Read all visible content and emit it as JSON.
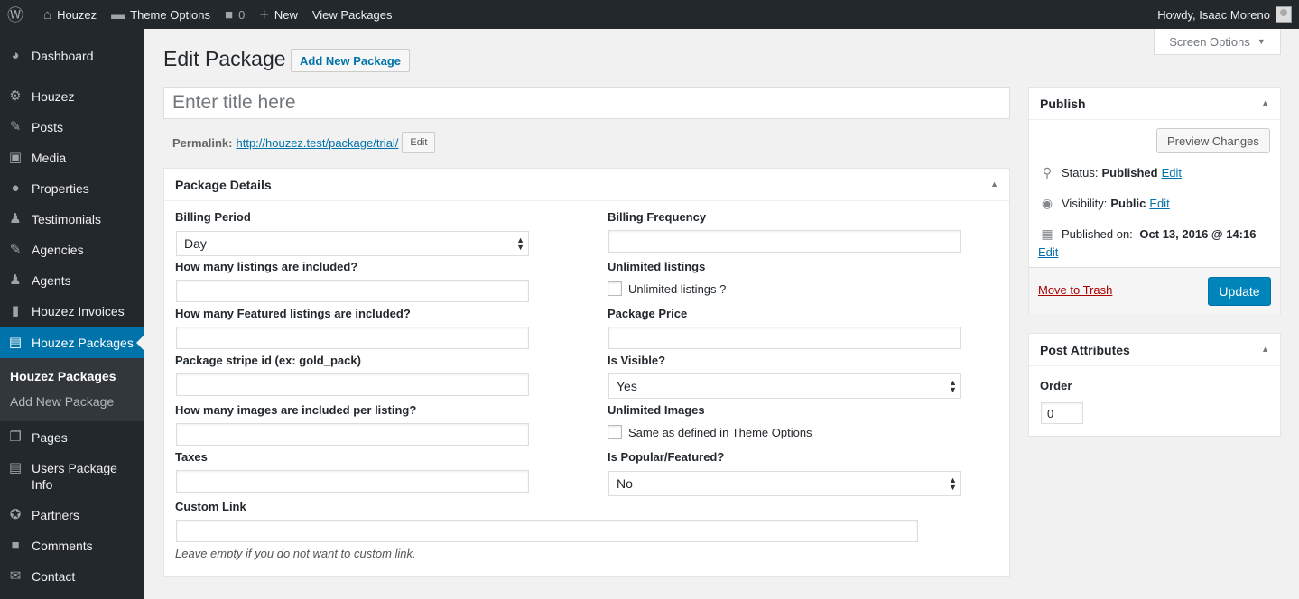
{
  "admin_bar": {
    "site_name": "Houzez",
    "theme_options": "Theme Options",
    "comments_count": "0",
    "new_label": "New",
    "view_label": "View Packages",
    "greeting": "Howdy, Isaac Moreno"
  },
  "sidebar": {
    "items": [
      {
        "label": "Dashboard",
        "icon": "dashboard-icon"
      },
      {
        "label": "Houzez",
        "icon": "gear-icon"
      },
      {
        "label": "Posts",
        "icon": "pin-icon"
      },
      {
        "label": "Media",
        "icon": "media-icon"
      },
      {
        "label": "Properties",
        "icon": "location-icon"
      },
      {
        "label": "Testimonials",
        "icon": "users-icon"
      },
      {
        "label": "Agencies",
        "icon": "pin-icon"
      },
      {
        "label": "Agents",
        "icon": "user-icon"
      },
      {
        "label": "Houzez Invoices",
        "icon": "book-icon"
      },
      {
        "label": "Houzez Packages",
        "icon": "id-card-icon"
      },
      {
        "label": "Pages",
        "icon": "pages-icon"
      },
      {
        "label": "Users Package Info",
        "icon": "id-card-icon"
      },
      {
        "label": "Partners",
        "icon": "award-icon"
      },
      {
        "label": "Comments",
        "icon": "comment-icon"
      },
      {
        "label": "Contact",
        "icon": "mail-icon"
      }
    ],
    "submenu": [
      "Houzez Packages",
      "Add New Package"
    ]
  },
  "screen_options": "Screen Options",
  "page": {
    "title": "Edit Package",
    "add_new": "Add New Package",
    "title_placeholder": "Enter title here",
    "permalink_label": "Permalink:",
    "permalink_url": "http://houzez.test/package/trial/",
    "permalink_edit": "Edit"
  },
  "package_details": {
    "heading": "Package Details",
    "billing_period_label": "Billing Period",
    "billing_period_value": "Day",
    "billing_frequency_label": "Billing Frequency",
    "listings_label": "How many listings are included?",
    "unlimited_listings_label": "Unlimited listings",
    "unlimited_listings_check": "Unlimited listings ?",
    "featured_label": "How many Featured listings are included?",
    "price_label": "Package Price",
    "stripe_label": "Package stripe id (ex: gold_pack)",
    "visible_label": "Is Visible?",
    "visible_value": "Yes",
    "images_label": "How many images are included per listing?",
    "unlimited_images_label": "Unlimited Images",
    "unlimited_images_check": "Same as defined in Theme Options",
    "taxes_label": "Taxes",
    "popular_label": "Is Popular/Featured?",
    "popular_value": "No",
    "custom_link_label": "Custom Link",
    "custom_link_hint": "Leave empty if you do not want to custom link."
  },
  "publish": {
    "heading": "Publish",
    "preview": "Preview Changes",
    "status_label": "Status:",
    "status_value": "Published",
    "visibility_label": "Visibility:",
    "visibility_value": "Public",
    "published_label": "Published on:",
    "published_value": "Oct 13, 2016 @ 14:16",
    "edit": "Edit",
    "trash": "Move to Trash",
    "update": "Update"
  },
  "post_attributes": {
    "heading": "Post Attributes",
    "order_label": "Order",
    "order_value": "0"
  }
}
